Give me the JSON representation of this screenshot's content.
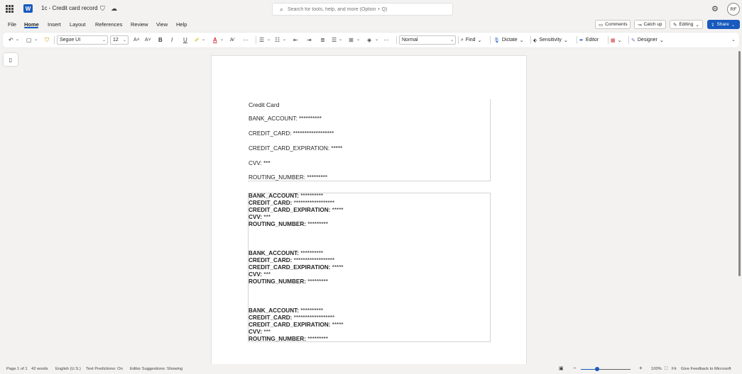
{
  "titlebar": {
    "app_logo": "W",
    "doc_title": "1c - Credit card record",
    "search_placeholder": "Search for tools, help, and more (Option + Q)",
    "avatar_initials": "RF"
  },
  "menu": {
    "items": [
      "File",
      "Home",
      "Insert",
      "Layout",
      "References",
      "Review",
      "View",
      "Help"
    ],
    "active": "Home",
    "comments": "Comments",
    "catchup": "Catch up",
    "editing": "Editing",
    "share": "Share"
  },
  "ribbon": {
    "font": "Segoe UI",
    "size": "12",
    "style": "Normal",
    "find": "Find",
    "dictate": "Dictate",
    "sensitivity": "Sensitivity",
    "editor": "Editor",
    "designer": "Designer"
  },
  "document": {
    "heading": "Credit Card",
    "table1": [
      "BANK_ACCOUNT: **********",
      "CREDIT_CARD: ******************",
      "CREDIT_CARD_EXPIRATION: *****",
      "CVV: ***",
      "ROUTING_NUMBER: *********"
    ],
    "table2_blocks": [
      [
        {
          "key": "BANK_ACCOUNT:",
          "val": " **********"
        },
        {
          "key": "CREDIT_CARD:",
          "val": " ******************"
        },
        {
          "key": "CREDIT_CARD_EXPIRATION:",
          "val": " *****"
        },
        {
          "key": "CVV:",
          "val": " ***"
        },
        {
          "key": "ROUTING_NUMBER:",
          "val": " *********"
        }
      ],
      [
        {
          "key": "BANK_ACCOUNT:",
          "val": " **********"
        },
        {
          "key": "CREDIT_CARD:",
          "val": " ******************"
        },
        {
          "key": "CREDIT_CARD_EXPIRATION:",
          "val": " *****"
        },
        {
          "key": "CVV:",
          "val": " ***"
        },
        {
          "key": "ROUTING_NUMBER:",
          "val": " *********"
        }
      ],
      [
        {
          "key": "BANK_ACCOUNT:",
          "val": " **********"
        },
        {
          "key": "CREDIT_CARD:",
          "val": " ******************"
        },
        {
          "key": "CREDIT_CARD_EXPIRATION:",
          "val": " *****"
        },
        {
          "key": "CVV:",
          "val": " ***"
        },
        {
          "key": "ROUTING_NUMBER:",
          "val": " *********"
        }
      ]
    ]
  },
  "status": {
    "page": "Page 1 of 1",
    "words": "42 words",
    "language": "English (U.S.)",
    "text_predictions": "Text Predictions: On",
    "editor_suggestions": "Editor Suggestions: Showing",
    "zoom": "100%",
    "fit": "Fit",
    "feedback": "Give Feedback to Microsoft"
  },
  "colors": {
    "accent": "#185abd",
    "background": "#f3f2f1"
  }
}
